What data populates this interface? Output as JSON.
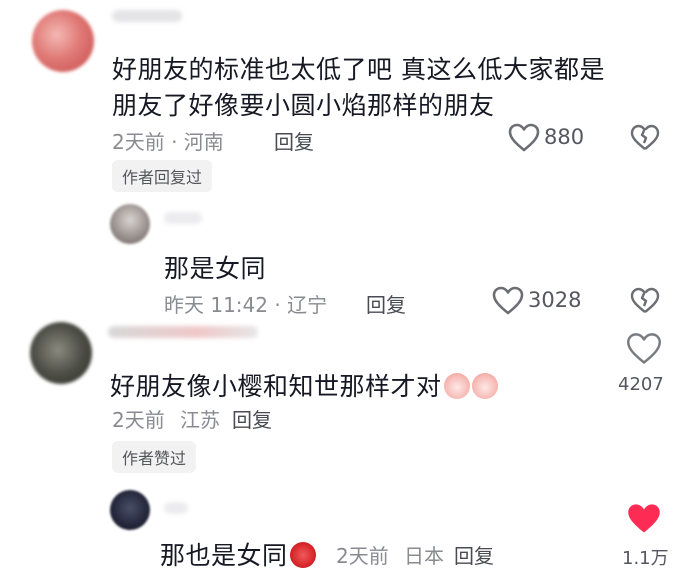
{
  "comments": [
    {
      "text_line1": "好朋友的标准也太低了吧 真这么低大家都是",
      "text_line2": "朋友了好像要小圆小焰那样的朋友",
      "time_location": "2天前 · 河南",
      "reply_label": "回复",
      "likes": "880",
      "badge": "作者回复过"
    },
    {
      "text": "那是女同",
      "time_location": "昨天 11:42 · 辽宁",
      "reply_label": "回复",
      "likes": "3028"
    },
    {
      "text": "好朋友像小樱和知世那样才对",
      "time": "2天前",
      "location": "江苏",
      "reply_label": "回复",
      "likes": "4207",
      "badge": "作者赞过"
    },
    {
      "text": "那也是女同",
      "time": "2天前",
      "location": "日本",
      "reply_label": "回复",
      "likes": "1.1万"
    }
  ],
  "colors": {
    "liked_heart": "#fe2c55",
    "icon_gray": "#7b7c82"
  }
}
